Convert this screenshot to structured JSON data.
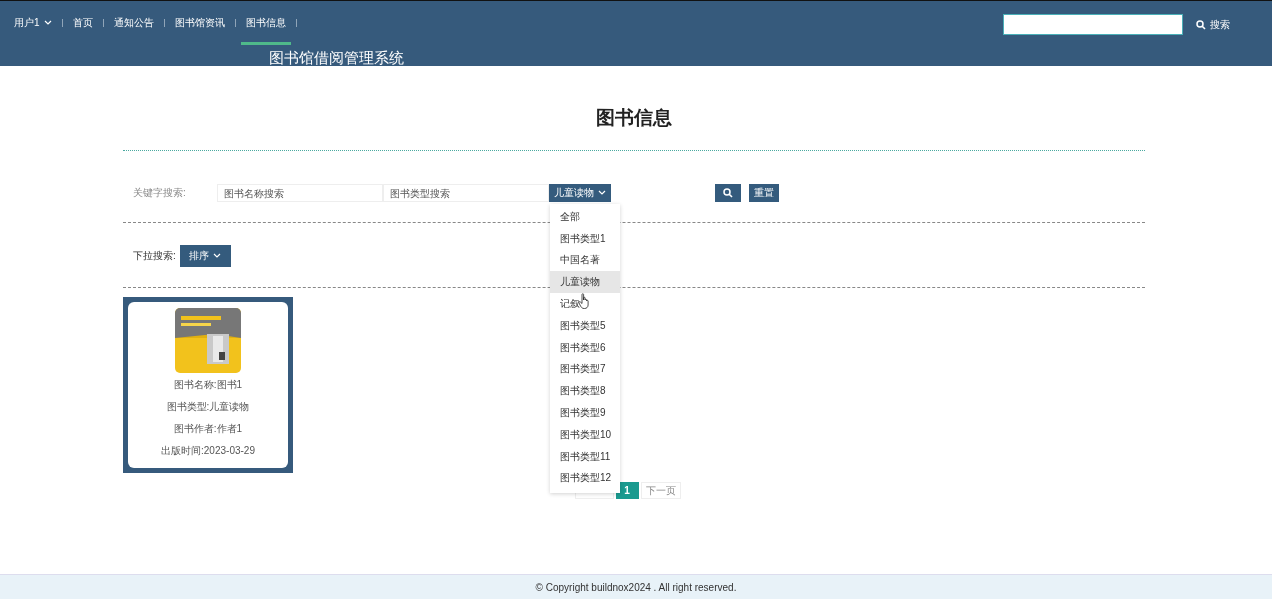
{
  "header": {
    "user_menu": "用户1",
    "nav_items": [
      {
        "label": "首页",
        "selected": false
      },
      {
        "label": "通知公告",
        "selected": false
      },
      {
        "label": "图书馆资讯",
        "selected": false
      },
      {
        "label": "图书信息",
        "selected": true
      }
    ],
    "site_title": "图书馆借阅管理系统",
    "search_button": "搜索"
  },
  "page_title": "图书信息",
  "filters": {
    "keyword_label": "关键字搜索:",
    "name_placeholder": "图书名称搜索",
    "type_placeholder": "图书类型搜索",
    "category_button": "儿童读物",
    "reset_button": "重置",
    "dropdown_label": "下拉搜索:",
    "sort_button": "排序",
    "category_options": [
      {
        "label": "全部",
        "selected": false
      },
      {
        "label": "图书类型1",
        "selected": false
      },
      {
        "label": "中国名著",
        "selected": false
      },
      {
        "label": "儿童读物",
        "selected": true
      },
      {
        "label": "记叙",
        "selected": false
      },
      {
        "label": "图书类型5",
        "selected": false
      },
      {
        "label": "图书类型6",
        "selected": false
      },
      {
        "label": "图书类型7",
        "selected": false
      },
      {
        "label": "图书类型8",
        "selected": false
      },
      {
        "label": "图书类型9",
        "selected": false
      },
      {
        "label": "图书类型10",
        "selected": false
      },
      {
        "label": "图书类型11",
        "selected": false
      },
      {
        "label": "图书类型12",
        "selected": false
      }
    ]
  },
  "books": [
    {
      "kind": "picture",
      "name": "图书名称:图书1",
      "type": "图书类型:儿童读物",
      "author": "图书作者:作者1",
      "date": "出版时间:2023-03-29"
    }
  ],
  "pagination": {
    "pages": [
      {
        "label": "1",
        "selected": true
      }
    ],
    "next": "下一页"
  },
  "footer": "© Copyright buildnox2024 . All right reserved."
}
